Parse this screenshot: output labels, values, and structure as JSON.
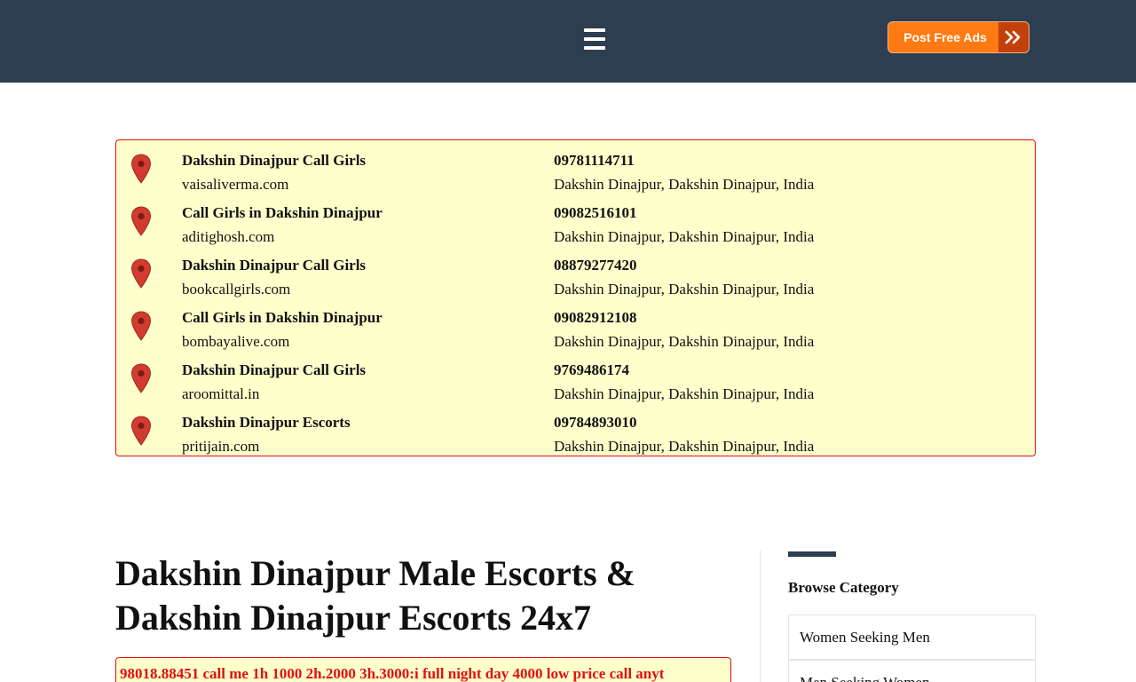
{
  "header": {
    "menu_icon": "hamburger-menu-icon",
    "post_button_label": "Post Free Ads",
    "post_button_icon": "double-chevron-right-icon",
    "colors": {
      "bar": "#2d3e50",
      "button": "#ff7a12",
      "button_arrow": "#c4400a"
    }
  },
  "listings": [
    {
      "title": "Dakshin Dinajpur Call Girls",
      "site": "vaisaliverma.com",
      "phone": "09781114711",
      "location": "Dakshin Dinajpur, Dakshin Dinajpur, India"
    },
    {
      "title": "Call Girls in Dakshin Dinajpur",
      "site": "aditighosh.com",
      "phone": "09082516101",
      "location": "Dakshin Dinajpur, Dakshin Dinajpur, India"
    },
    {
      "title": "Dakshin Dinajpur Call Girls",
      "site": "bookcallgirls.com",
      "phone": "08879277420",
      "location": "Dakshin Dinajpur, Dakshin Dinajpur, India"
    },
    {
      "title": "Call Girls in Dakshin Dinajpur",
      "site": "bombayalive.com",
      "phone": "09082912108",
      "location": "Dakshin Dinajpur, Dakshin Dinajpur, India"
    },
    {
      "title": "Dakshin Dinajpur Call Girls",
      "site": "aroomittal.in",
      "phone": "9769486174",
      "location": "Dakshin Dinajpur, Dakshin Dinajpur, India"
    },
    {
      "title": "Dakshin Dinajpur Escorts",
      "site": "pritijain.com",
      "phone": "09784893010",
      "location": "Dakshin Dinajpur, Dakshin Dinajpur, India"
    }
  ],
  "listing_icon": "map-pin-icon",
  "main": {
    "title_line1": "Dakshin Dinajpur Male Escorts &",
    "title_line2": "Dakshin Dinajpur Escorts 24x7",
    "ad_text": "98018.88451 call me 1h 1000 2h.2000 3h.3000:i full night day 4000 low price call anyt"
  },
  "sidebar": {
    "heading": "Browse Category",
    "categories": [
      "Women Seeking Men",
      "Men Seeking Women"
    ]
  }
}
